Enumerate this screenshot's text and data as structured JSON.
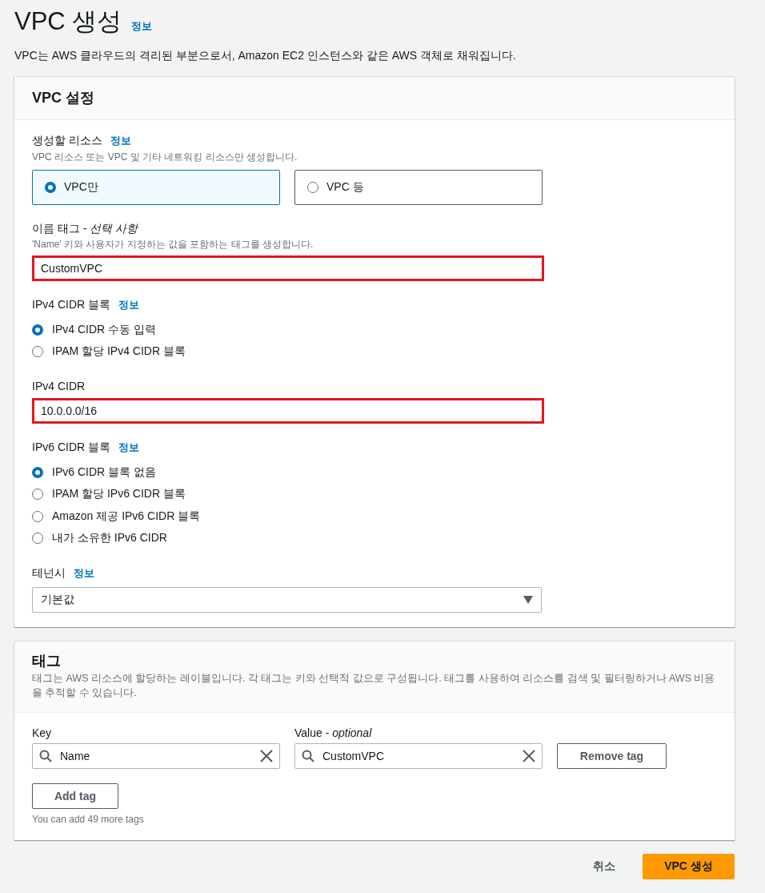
{
  "page": {
    "title": "VPC 생성",
    "info_link": "정보",
    "description": "VPC는 AWS 클라우드의 격리된 부분으로서, Amazon EC2 인스턴스와 같은 AWS 객체로 채워집니다."
  },
  "vpc_settings": {
    "title": "VPC 설정",
    "fields": [
      {
        "kind": "tiles",
        "label": "생성할 리소스",
        "info_link": "정보",
        "description": "VPC 리소스 또는 VPC 및 기타 네트워킹 리소스만 생성합니다.",
        "options": [
          {
            "label": "VPC만",
            "selected": true
          },
          {
            "label": "VPC 등",
            "selected": false
          }
        ]
      },
      {
        "kind": "input",
        "label": "이름 태그 - *선택 사항*",
        "description": "'Name' 키와 사용자가 지정하는 값을 포함하는 태그를 생성합니다.",
        "value": "CustomVPC",
        "highlighted": true
      },
      {
        "kind": "radios",
        "label": "IPv4 CIDR 블록",
        "info_link": "정보",
        "options": [
          {
            "label": "IPv4 CIDR 수동 입력",
            "selected": true
          },
          {
            "label": "IPAM 할당 IPv4 CIDR 블록",
            "selected": false
          }
        ]
      },
      {
        "kind": "input",
        "label": "IPv4 CIDR",
        "value": "10.0.0.0/16",
        "highlighted": true
      },
      {
        "kind": "radios",
        "label": "IPv6 CIDR 블록",
        "info_link": "정보",
        "options": [
          {
            "label": "IPv6 CIDR 블록 없음",
            "selected": true
          },
          {
            "label": "IPAM 할당 IPv6 CIDR 블록",
            "selected": false
          },
          {
            "label": "Amazon 제공 IPv6 CIDR 블록",
            "selected": false
          },
          {
            "label": "내가 소유한 IPv6 CIDR",
            "selected": false
          }
        ]
      },
      {
        "kind": "select",
        "label": "테넌시",
        "info_link": "정보",
        "value": "기본값"
      }
    ]
  },
  "tags": {
    "title": "태그",
    "description": "태그는 AWS 리소스에 할당하는 레이블입니다. 각 태그는 키와 선택적 값으로 구성됩니다. 태그를 사용하여 리소스를 검색 및 필터링하거나 AWS 비용을 추적할 수 있습니다.",
    "key_label": "Key",
    "value_label": "Value - *optional*",
    "rows": [
      {
        "key": "Name",
        "value": "CustomVPC",
        "remove_button": "Remove tag"
      }
    ],
    "add_button": "Add tag",
    "limit_note": "You can add 49 more tags"
  },
  "footer": {
    "cancel": "취소",
    "submit": "VPC 생성"
  }
}
